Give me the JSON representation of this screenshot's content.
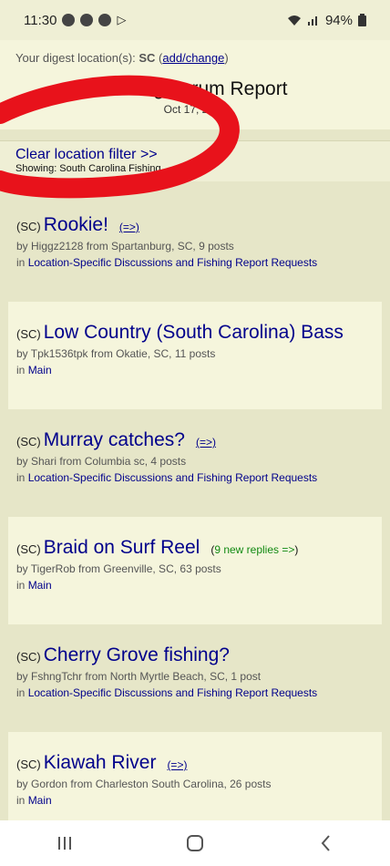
{
  "status": {
    "time": "11:30",
    "battery": "94%"
  },
  "digest": {
    "prefix": "Your digest location(s): ",
    "location": "SC",
    "link": "add/change"
  },
  "header": {
    "title": "Fishing Forum Report",
    "date": "Oct 17, 2023"
  },
  "filter": {
    "clear_label": "Clear location filter >>",
    "showing": "Showing: South Carolina Fishing"
  },
  "posts": [
    {
      "tag": "(SC)",
      "title": "Rookie!",
      "action": "(=>)",
      "byline": "by Higgz2128 from Spartanburg, SC, 9 posts",
      "in_prefix": "in ",
      "in_forum": "Location-Specific Discussions and Fishing Report Requests"
    },
    {
      "tag": "(SC)",
      "title": "Low Country (South Carolina) Bass",
      "action": "",
      "byline": "by Tpk1536tpk from Okatie, SC, 11 posts",
      "in_prefix": "in ",
      "in_forum": "Main"
    },
    {
      "tag": "(SC)",
      "title": "Murray catches?",
      "action": "(=>)",
      "byline": "by Shari from Columbia sc, 4 posts",
      "in_prefix": "in ",
      "in_forum": "Location-Specific Discussions and Fishing Report Requests"
    },
    {
      "tag": "(SC)",
      "title": "Braid on Surf Reel",
      "new_replies": "9 new replies =>",
      "byline": "by TigerRob from Greenville, SC, 63 posts",
      "in_prefix": "in ",
      "in_forum": "Main"
    },
    {
      "tag": "(SC)",
      "title": "Cherry Grove fishing?",
      "action": "",
      "byline": "by FshngTchr from North Myrtle Beach, SC, 1 post",
      "in_prefix": "in ",
      "in_forum": "Location-Specific Discussions and Fishing Report Requests"
    },
    {
      "tag": "(SC)",
      "title": "Kiawah River",
      "action": "(=>)",
      "byline": "by Gordon from Charleston South Carolina, 26 posts",
      "in_prefix": "in ",
      "in_forum": "Main"
    }
  ],
  "colors": {
    "link": "#00008b",
    "new_replies": "#138a13",
    "scribble": "#e8121b",
    "bg": "#f5f5dc"
  },
  "icons": [
    "wifi-icon",
    "signal-icon",
    "battery-icon",
    "recent-apps-icon",
    "home-icon",
    "back-icon"
  ]
}
